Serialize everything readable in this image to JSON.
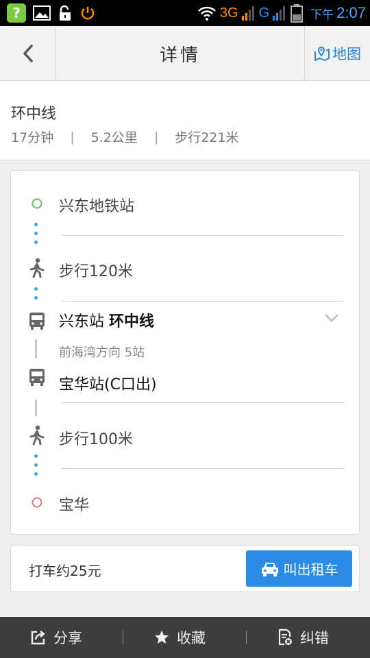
{
  "status_bar": {
    "network_3g": "3G",
    "network_g": "G",
    "ampm": "下午",
    "time": "2:07"
  },
  "header": {
    "title": "详情",
    "map_label": "地图"
  },
  "summary": {
    "route_name": "环中线",
    "duration": "17分钟",
    "distance": "5.2公里",
    "walk": "步行221米",
    "separator": "|"
  },
  "steps": [
    {
      "type": "start",
      "text": "兴东地铁站"
    },
    {
      "type": "walk",
      "text": "步行120米"
    },
    {
      "type": "bus",
      "station": "兴东站",
      "line": "环中线",
      "sub": "前海湾方向 5站"
    },
    {
      "type": "bus",
      "text": "宝华站(C口出)"
    },
    {
      "type": "walk",
      "text": "步行100米"
    },
    {
      "type": "end",
      "text": "宝华"
    }
  ],
  "taxi": {
    "price_text": "打车约25元",
    "button_label": "叫出租车"
  },
  "bottom_bar": {
    "share": "分享",
    "favorite": "收藏",
    "report": "纠错"
  },
  "colors": {
    "accent": "#2a8ce6",
    "start_dot": "#5cc35c",
    "end_dot": "#e27a7a",
    "walk_dots": "#35a6e8"
  },
  "icons": [
    "question-app-icon",
    "image-icon",
    "unlock-icon",
    "power-icon",
    "wifi-icon",
    "signal-icon",
    "battery-icon",
    "back-arrow-icon",
    "map-pin-icon",
    "walk-icon",
    "bus-icon",
    "chevron-down-icon",
    "taxi-icon",
    "share-icon",
    "star-icon",
    "report-icon"
  ]
}
